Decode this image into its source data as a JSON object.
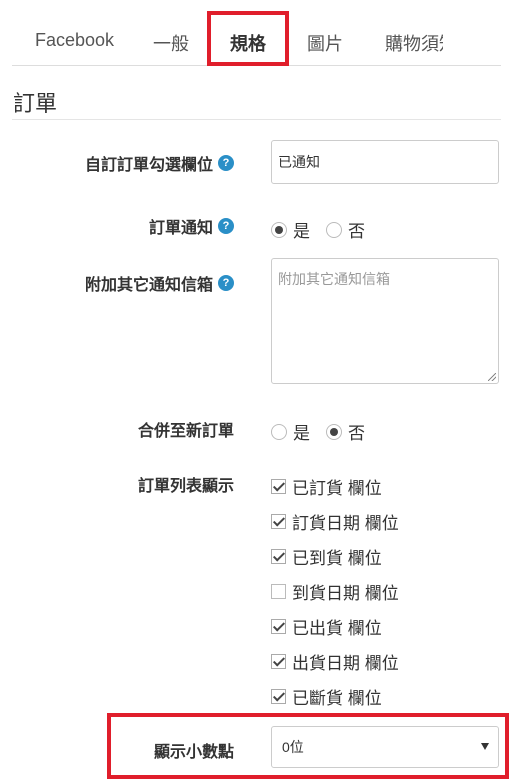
{
  "tabs": [
    {
      "label": "Facebook"
    },
    {
      "label": "一般"
    },
    {
      "label": "規格"
    },
    {
      "label": "圖片"
    },
    {
      "label": "購物須知"
    }
  ],
  "section": {
    "title": "訂單"
  },
  "fields": {
    "custom_checkbox": {
      "label": "自訂訂單勾選欄位",
      "value": "已通知"
    },
    "notify": {
      "label": "訂單通知",
      "options": [
        "是",
        "否"
      ],
      "selected": "是"
    },
    "extra_email": {
      "label": "附加其它通知信箱",
      "placeholder": "附加其它通知信箱"
    },
    "merge": {
      "label": "合併至新訂單",
      "options": [
        "是",
        "否"
      ],
      "selected": "否"
    },
    "list_display": {
      "label": "訂單列表顯示",
      "items": [
        {
          "label": "已訂貨 欄位",
          "checked": true
        },
        {
          "label": "訂貨日期 欄位",
          "checked": true
        },
        {
          "label": "已到貨 欄位",
          "checked": true
        },
        {
          "label": "到貨日期 欄位",
          "checked": false
        },
        {
          "label": "已出貨 欄位",
          "checked": true
        },
        {
          "label": "出貨日期 欄位",
          "checked": true
        },
        {
          "label": "已斷貨 欄位",
          "checked": true
        }
      ]
    },
    "decimal": {
      "label": "顯示小數點",
      "value": "0位"
    }
  },
  "help_glyph": "?",
  "colors": {
    "highlight_box": "#e01e2b",
    "help_icon": "#2a8fc7"
  }
}
